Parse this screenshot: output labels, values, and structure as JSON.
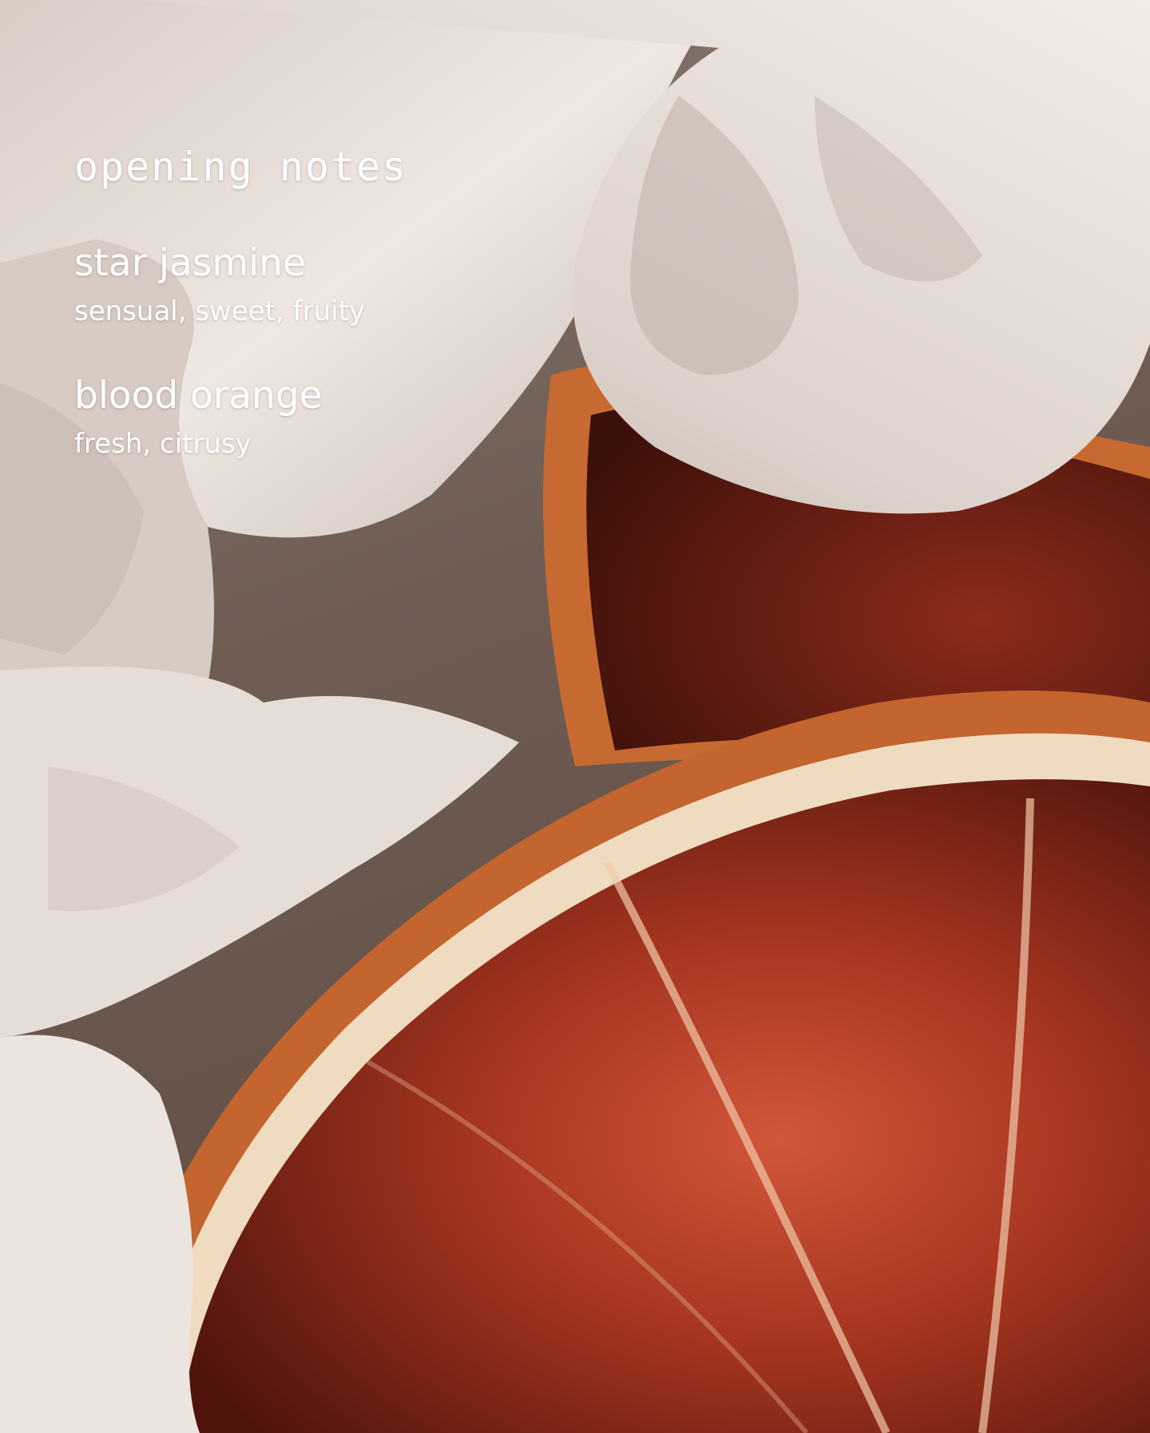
{
  "heading": "opening notes",
  "notes": [
    {
      "name": "star jasmine",
      "description": "sensual, sweet, fruity"
    },
    {
      "name": "blood orange",
      "description": "fresh, citrusy"
    }
  ],
  "colors": {
    "fabric": "#e8e0db",
    "fabric_shadow": "#b9aca4",
    "rind": "#c4642e",
    "pith": "#efdcc0",
    "flesh": "#8a2a18",
    "flesh_light": "#c24a2c",
    "text": "#ffffff"
  }
}
